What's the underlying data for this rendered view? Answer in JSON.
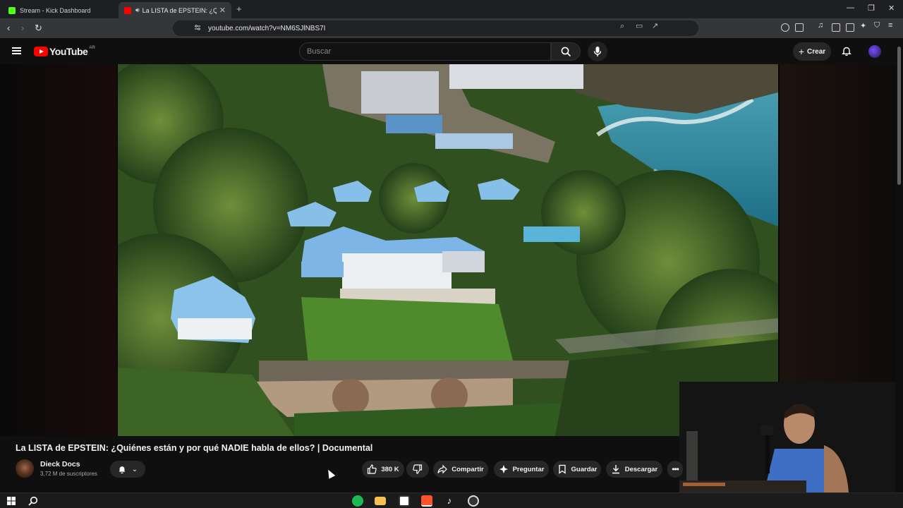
{
  "browser": {
    "tabs": [
      {
        "label": "Stream - Kick Dashboard",
        "active": false
      },
      {
        "label": "La LISTA de EPSTEIN: ¿Quiénes",
        "active": true
      }
    ],
    "url": "youtube.com/watch?v=NM6SJlNBS7I"
  },
  "youtube": {
    "logo_text": "YouTube",
    "country_code": "AR",
    "search_placeholder": "Buscar",
    "create_label": "Crear"
  },
  "video": {
    "title": "La LISTA de EPSTEIN: ¿Quiénes están y por qué NADIE habla de ellos? | Documental",
    "channel_name": "Dieck Docs",
    "subscribers": "3,72 M de suscriptores",
    "likes": "380 K",
    "actions": {
      "share": "Compartir",
      "ask": "Preguntar",
      "save": "Guardar",
      "download": "Descargar"
    }
  },
  "colors": {
    "brand_red": "#ff0000",
    "bg": "#0f0f0f",
    "pill": "#272727"
  }
}
